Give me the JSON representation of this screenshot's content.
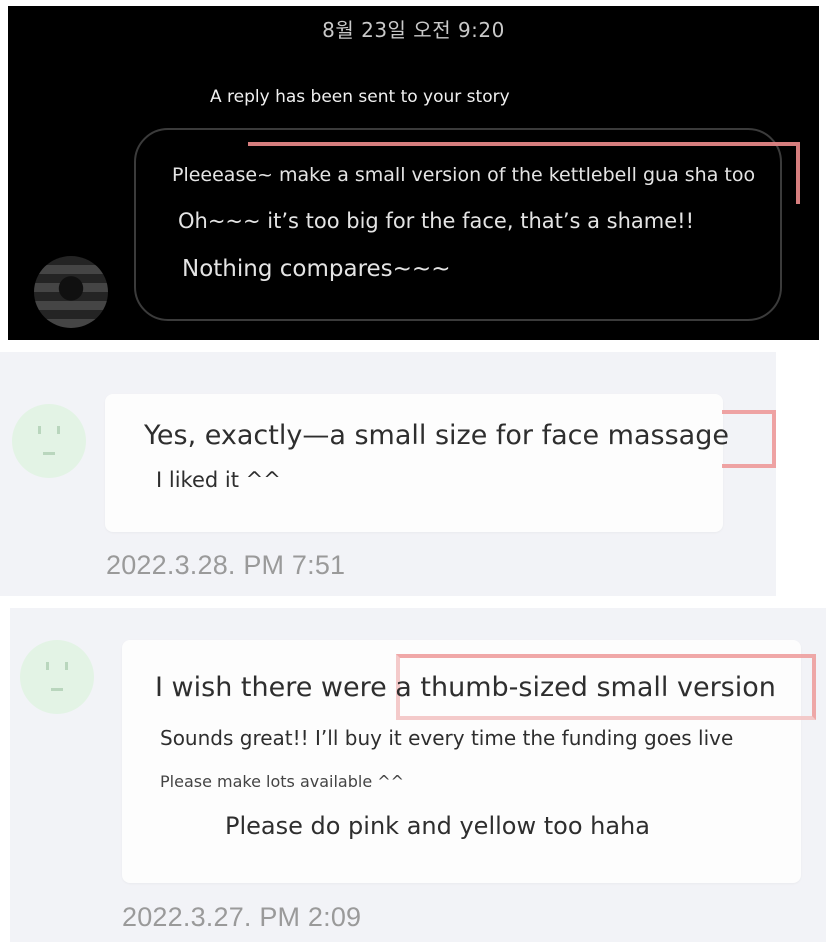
{
  "story": {
    "timestamp": "8월 23일 오전 9:20",
    "notice": "A reply has been sent to your story",
    "lines": [
      "Pleeease~ make a small version of the kettlebell gua sha too",
      "Oh~~~ it’s too big for the face, that’s a shame!!",
      "Nothing compares~~~"
    ]
  },
  "reviews": [
    {
      "lines": [
        "Yes, exactly—a small size for face massage",
        "I liked it ^^"
      ],
      "date": "2022.3.28. PM 7:51"
    },
    {
      "lines": [
        "I wish there were a thumb-sized small version",
        "Sounds great!! I’ll buy it every time the funding goes live",
        "Please make lots available ^^",
        "Please do pink and yellow too haha"
      ],
      "date": "2022.3.27. PM 2:09"
    }
  ],
  "colors": {
    "highlight": "#ee9a9a",
    "review_bg": "#f2f3f7",
    "avatar_bg": "#e3f3e5"
  }
}
